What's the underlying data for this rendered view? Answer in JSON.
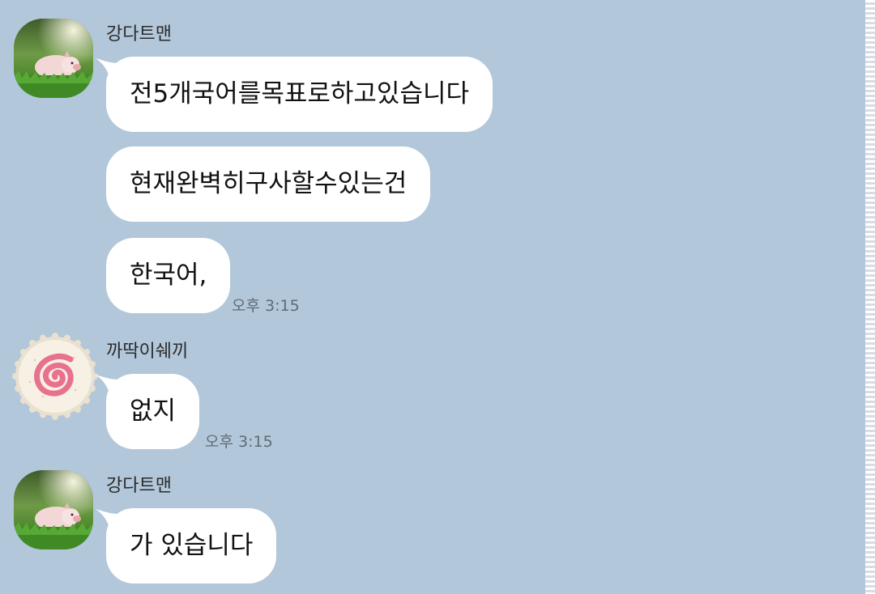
{
  "messages": [
    {
      "sender": "강다트맨",
      "avatar_icon": "piglet-photo",
      "bubbles": [
        "전5개국어를목표로하고있습니다",
        "현재완벽히구사할수있는건",
        "한국어,"
      ],
      "time": "오후 3:15"
    },
    {
      "sender": "까딱이쉐끼",
      "avatar_icon": "naruto-fishcake-sticker",
      "bubbles": [
        "없지"
      ],
      "time": "오후 3:15"
    },
    {
      "sender": "강다트맨",
      "avatar_icon": "piglet-photo",
      "bubbles": [
        "가 있습니다"
      ]
    }
  ],
  "colors": {
    "background": "#b2c7da",
    "bubble": "#ffffff",
    "timestamp": "#5f6b77"
  }
}
